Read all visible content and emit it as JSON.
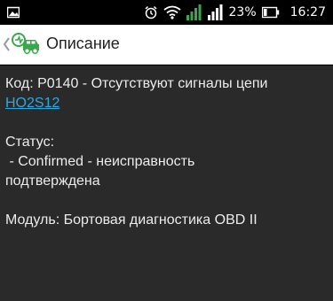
{
  "status_bar": {
    "battery_percent": "23%",
    "time": "16:27",
    "icons": [
      "image-icon",
      "alarm-icon",
      "wifi-icon",
      "signal-icon",
      "battery-icon"
    ]
  },
  "action_bar": {
    "title": "Описание",
    "logo_icon": "car-diagnostic-logo-icon",
    "back_icon": "chevron-left-icon"
  },
  "content": {
    "code_text": "Код: P0140 - Отсутствуют сигналы цепи",
    "code_link": "HO2S12",
    "status_label": "Статус:",
    "status_value_line1": " - Confirmed - неисправность",
    "status_value_line2": "подтверждена",
    "module_text": "Модуль: Бортовая диагностика OBD II"
  },
  "colors": {
    "content_bg": "#2a2a2a",
    "text": "#ececec",
    "link": "#2aa9e0",
    "accent_green": "#3aa84a"
  }
}
